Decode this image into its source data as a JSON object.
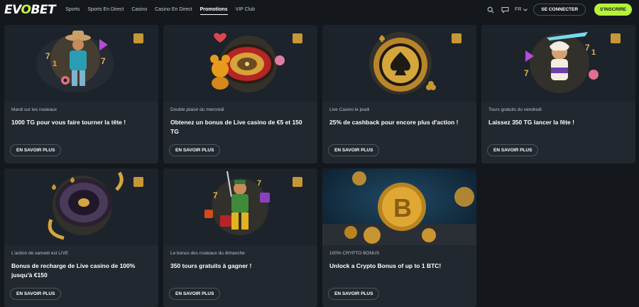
{
  "header": {
    "logo_left": "EV",
    "logo_mid": "O",
    "logo_right": "BET",
    "nav": [
      {
        "label": "Sports"
      },
      {
        "label": "Sports En Direct"
      },
      {
        "label": "Casino"
      },
      {
        "label": "Casino En Direct"
      },
      {
        "label": "Promotions"
      },
      {
        "label": "VIP Club"
      }
    ],
    "lang": "FR",
    "login_label": "SE CONNECTER",
    "signup_label": "S'INSCRIRE"
  },
  "colors": {
    "accent": "#b6f23a",
    "background": "#14181d",
    "card": "#222830"
  },
  "promotions": [
    {
      "subtitle": "Mardi sur les rouleaux",
      "title": "1000 TG pour vous faire tourner la tête !",
      "cta": "EN SAVOIR PLUS",
      "art": "cowboy-character"
    },
    {
      "subtitle": "Double plaisir du mercredi",
      "title": "Obtenez un bonus de Live casino de €5 et 150 TG",
      "cta": "EN SAVOIR PLUS",
      "art": "roulette-teddy"
    },
    {
      "subtitle": "Live Casino le jeudi",
      "title": "25% de cashback pour encore plus d'action !",
      "cta": "EN SAVOIR PLUS",
      "art": "spade-chip"
    },
    {
      "subtitle": "Tours gratuits du vendredi",
      "title": "Laissez 350 TG lancer la fête !",
      "cta": "EN SAVOIR PLUS",
      "art": "zeus-character"
    },
    {
      "subtitle": "L'action de samedi est LIVE",
      "title": "Bonus de recharge de Live casino de 100% jusqu'à €150",
      "cta": "EN SAVOIR PLUS",
      "art": "roulette-wheel"
    },
    {
      "subtitle": "Le bonus des rouleaux du dimanche",
      "title": "350 tours gratuits à gagner !",
      "cta": "EN SAVOIR PLUS",
      "art": "miner-character"
    },
    {
      "subtitle": "100% CRYPTO BONUS",
      "title": "Unlock a Crypto Bonus of up to 1 BTC!",
      "cta": "EN SAVOIR PLUS",
      "art": "bitcoin-coins"
    }
  ]
}
